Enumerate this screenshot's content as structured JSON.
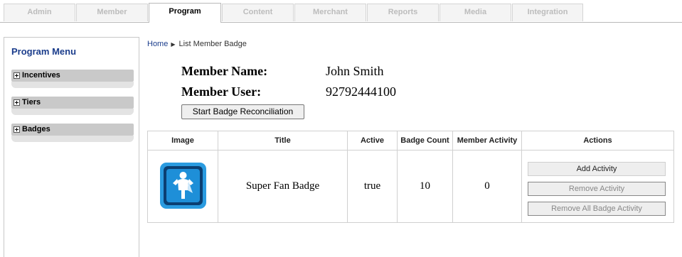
{
  "tabs": [
    {
      "label": "Admin",
      "active": false
    },
    {
      "label": "Member",
      "active": false
    },
    {
      "label": "Program",
      "active": true
    },
    {
      "label": "Content",
      "active": false
    },
    {
      "label": "Merchant",
      "active": false
    },
    {
      "label": "Reports",
      "active": false
    },
    {
      "label": "Media",
      "active": false
    },
    {
      "label": "Integration",
      "active": false
    }
  ],
  "sidebar": {
    "title": "Program Menu",
    "items": [
      {
        "label": "Incentives"
      },
      {
        "label": "Tiers"
      },
      {
        "label": "Badges"
      }
    ]
  },
  "breadcrumb": {
    "home": "Home",
    "current": "List Member Badge"
  },
  "member": {
    "name_label": "Member Name:",
    "name_value": "John Smith",
    "user_label": "Member User:",
    "user_value": "92792444100"
  },
  "reconcile_button": "Start Badge Reconciliation",
  "table": {
    "headers": [
      "Image",
      "Title",
      "Active",
      "Badge Count",
      "Member Activity",
      "Actions"
    ],
    "rows": [
      {
        "image_icon": "super-fan-badge-icon",
        "title": "Super Fan Badge",
        "active": "true",
        "badge_count": "10",
        "member_activity": "0",
        "actions": [
          "Add Activity",
          "Remove Activity",
          "Remove All Badge Activity"
        ]
      }
    ]
  },
  "colors": {
    "sidebar_title": "#1b3d8c",
    "badge_blue": "#1e8fd8",
    "badge_dark": "#0b3f72"
  }
}
